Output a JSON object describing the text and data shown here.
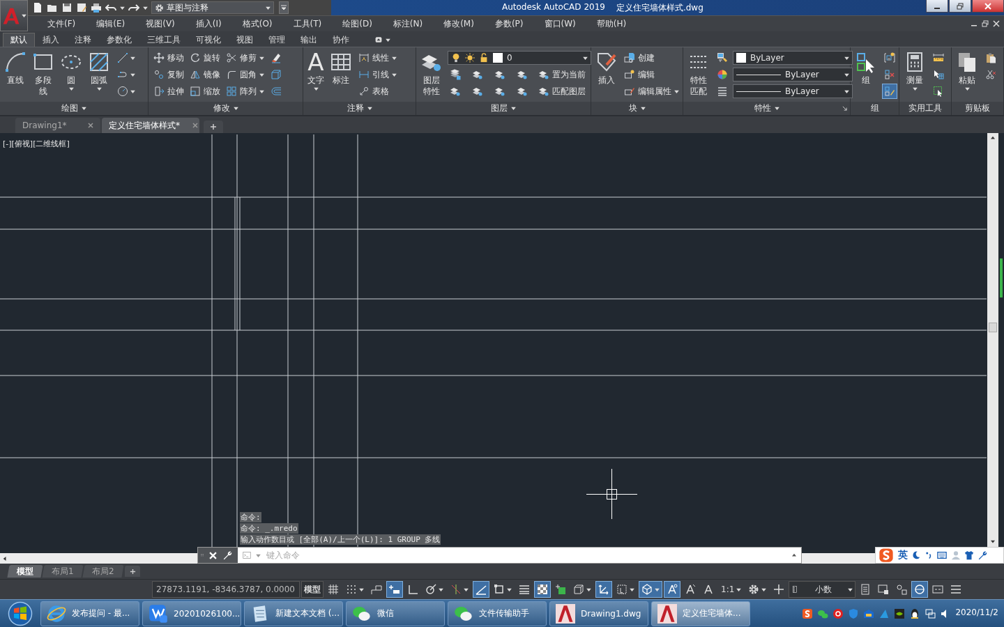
{
  "title_bar": {
    "workspace": "草图与注释",
    "app_name": "Autodesk AutoCAD 2019",
    "file_name": "定义住宅墙体样式.dwg"
  },
  "menu": [
    "文件(F)",
    "编辑(E)",
    "视图(V)",
    "插入(I)",
    "格式(O)",
    "工具(T)",
    "绘图(D)",
    "标注(N)",
    "修改(M)",
    "参数(P)",
    "窗口(W)",
    "帮助(H)"
  ],
  "ribbon_tabs": [
    {
      "label": "默认",
      "selected": true
    },
    {
      "label": "插入",
      "selected": false
    },
    {
      "label": "注释",
      "selected": false
    },
    {
      "label": "参数化",
      "selected": false
    },
    {
      "label": "三维工具",
      "selected": false
    },
    {
      "label": "可视化",
      "selected": false
    },
    {
      "label": "视图",
      "selected": false
    },
    {
      "label": "管理",
      "selected": false
    },
    {
      "label": "输出",
      "selected": false
    },
    {
      "label": "协作",
      "selected": false
    }
  ],
  "ribbon_panels": [
    {
      "title": "绘图",
      "large": [
        {
          "kind": "large",
          "label": "直线"
        },
        {
          "kind": "large",
          "label": "多段线"
        },
        {
          "kind": "large_split",
          "label": "圆"
        },
        {
          "kind": "large_split",
          "label": "圆弧"
        }
      ],
      "rows": [
        [
          {
            "kind": "icon_split"
          }
        ],
        [
          {
            "kind": "icon_split"
          }
        ],
        [
          {
            "kind": "icon_split"
          }
        ]
      ]
    },
    {
      "title": "修改",
      "rows": [
        [
          {
            "kind": "small",
            "label": "移动"
          },
          {
            "kind": "small",
            "label": "旋转"
          },
          {
            "kind": "small_split",
            "label": "修剪"
          },
          {
            "kind": "icon"
          }
        ],
        [
          {
            "kind": "small",
            "label": "复制"
          },
          {
            "kind": "small",
            "label": "镜像"
          },
          {
            "kind": "small_split",
            "label": "圆角"
          },
          {
            "kind": "icon"
          }
        ],
        [
          {
            "kind": "small",
            "label": "拉伸"
          },
          {
            "kind": "small",
            "label": "缩放"
          },
          {
            "kind": "small_split",
            "label": "阵列"
          },
          {
            "kind": "icon"
          }
        ]
      ]
    },
    {
      "title": "注释",
      "large": [
        {
          "kind": "large_glyph",
          "glyph": "A",
          "label": "文字"
        },
        {
          "kind": "large",
          "label": "标注"
        }
      ],
      "rows": [
        [
          {
            "kind": "small_split",
            "label": "线性"
          }
        ],
        [
          {
            "kind": "small_split",
            "label": "引线"
          }
        ],
        [
          {
            "kind": "small",
            "label": "表格"
          }
        ]
      ]
    },
    {
      "title": "图层",
      "large": [
        {
          "kind": "large",
          "label": "图层特性"
        }
      ],
      "rows": [
        [
          {
            "kind": "layer_dropdown",
            "label": "0"
          }
        ],
        [
          {
            "kind": "icon"
          },
          {
            "kind": "icon"
          },
          {
            "kind": "icon"
          },
          {
            "kind": "icon"
          },
          {
            "kind": "small",
            "label": "置为当前"
          }
        ],
        [
          {
            "kind": "icon"
          },
          {
            "kind": "icon"
          },
          {
            "kind": "icon"
          },
          {
            "kind": "icon"
          },
          {
            "kind": "small",
            "label": "匹配图层"
          }
        ]
      ]
    },
    {
      "title": "块",
      "large": [
        {
          "kind": "large",
          "label": "插入"
        }
      ],
      "rows": [
        [
          {
            "kind": "small",
            "label": "创建"
          }
        ],
        [
          {
            "kind": "small",
            "label": "编辑"
          }
        ],
        [
          {
            "kind": "small_split",
            "label": "编辑属性"
          }
        ]
      ]
    },
    {
      "title": "特性",
      "large": [
        {
          "kind": "large",
          "label": "特性匹配"
        }
      ],
      "rows": [
        [
          {
            "kind": "icon"
          },
          {
            "kind": "color_dropdown",
            "label": "ByLayer"
          }
        ],
        [
          {
            "kind": "icon"
          },
          {
            "kind": "line_dropdown",
            "label": "ByLayer"
          }
        ],
        [
          {
            "kind": "icon"
          },
          {
            "kind": "line_dropdown",
            "label": "ByLayer"
          }
        ]
      ]
    },
    {
      "title": "组",
      "large": [
        {
          "kind": "large",
          "label": "组"
        }
      ],
      "rows": [
        [
          {
            "kind": "icon",
            "on": false
          }
        ],
        [
          {
            "kind": "icon",
            "on": false
          }
        ],
        [
          {
            "kind": "icon",
            "on": true
          }
        ]
      ]
    },
    {
      "title": "实用工具",
      "large": [
        {
          "kind": "large_split",
          "label": "测量"
        }
      ],
      "rows": [
        [
          {
            "kind": "icon"
          }
        ],
        [
          {
            "kind": "icon"
          }
        ],
        [
          {
            "kind": "icon"
          }
        ]
      ]
    },
    {
      "title": "剪贴板",
      "large": [
        {
          "kind": "large_split",
          "label": "粘贴"
        }
      ],
      "rows": [
        [
          {
            "kind": "icon"
          }
        ],
        [
          {
            "kind": "icon"
          }
        ]
      ]
    }
  ],
  "file_tabs": [
    {
      "label": "Drawing1*",
      "selected": false
    },
    {
      "label": "定义住宅墙体样式*",
      "selected": true
    }
  ],
  "viewport_label": "[-][俯视][二维线框]",
  "command_history": [
    "命令:",
    "命令: _.mredo",
    "输入动作数目或 [全部(A)/上一个(L)]: 1 GROUP 多线"
  ],
  "command_line": {
    "placeholder": "键入命令"
  },
  "ime_bar": {
    "mode": "英"
  },
  "layout_tabs": [
    {
      "label": "模型",
      "selected": true
    },
    {
      "label": "布局1",
      "selected": false
    },
    {
      "label": "布局2",
      "selected": false
    }
  ],
  "status_bar": {
    "coordinates": "27873.1191, -8346.3787, 0.0000",
    "items": [
      {
        "kind": "label",
        "label": "模型"
      },
      {
        "kind": "toggle",
        "on": false
      },
      {
        "kind": "toggle_split",
        "on": false
      },
      {
        "kind": "toggle",
        "on": false
      },
      {
        "kind": "toggle",
        "on": true
      },
      {
        "kind": "toggle",
        "on": false
      },
      {
        "kind": "toggle_split",
        "on": false
      },
      {
        "kind": "toggle_split",
        "on": false
      },
      {
        "kind": "toggle",
        "on": true
      },
      {
        "kind": "toggle_split",
        "on": false
      },
      {
        "kind": "toggle",
        "on": false
      },
      {
        "kind": "toggle",
        "on": true
      },
      {
        "kind": "toggle",
        "on": false
      },
      {
        "kind": "toggle_split",
        "on": false
      },
      {
        "kind": "toggle",
        "on": true
      },
      {
        "kind": "toggle_split",
        "on": false
      },
      {
        "kind": "toggle_split",
        "on": true
      },
      {
        "kind": "toggle",
        "on": true
      },
      {
        "kind": "toggle",
        "on": false
      },
      {
        "kind": "toggle",
        "on": false
      },
      {
        "kind": "label_split",
        "label": "1:1"
      },
      {
        "kind": "toggle_split",
        "on": false
      },
      {
        "kind": "toggle",
        "on": false
      },
      {
        "kind": "units",
        "label": "小数"
      },
      {
        "kind": "toggle",
        "on": false
      },
      {
        "kind": "toggle",
        "on": false
      },
      {
        "kind": "toggle",
        "on": false
      },
      {
        "kind": "toggle",
        "on": true
      },
      {
        "kind": "toggle",
        "on": false
      },
      {
        "kind": "toggle",
        "on": false
      }
    ]
  },
  "taskbar": {
    "items": [
      {
        "label": "发布提问 - 最...",
        "selected": false
      },
      {
        "label": "20201026100...",
        "selected": false
      },
      {
        "label": "新建文本文档 (...",
        "selected": false
      },
      {
        "label": "微信",
        "selected": false
      },
      {
        "label": "文件传输助手",
        "selected": false
      },
      {
        "label": "Drawing1.dwg",
        "selected": false
      },
      {
        "label": "定义住宅墙体...",
        "selected": true
      }
    ],
    "date": "2020/11/2"
  }
}
